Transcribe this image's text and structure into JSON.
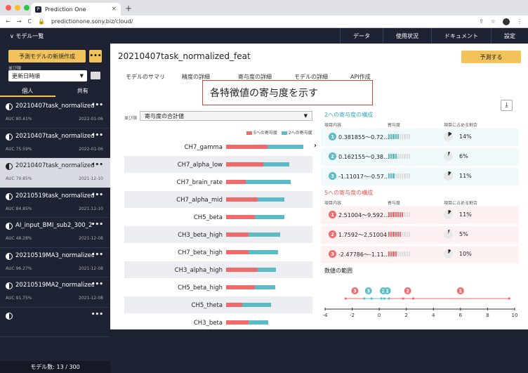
{
  "browser": {
    "tab_title": "Prediction One",
    "tab_close": "×",
    "new_tab": "+",
    "url": "predictionone.sony.biz/cloud/",
    "nav_back": "←",
    "nav_forward": "→",
    "nav_reload": "C",
    "lock": "🔒",
    "share": "⇪",
    "star": "☆",
    "menu": "⋮",
    "favicon": "P"
  },
  "appbar": {
    "model_list": "∨ モデル一覧",
    "nav": [
      "データ",
      "使用状況",
      "ドキュメント",
      "設定"
    ]
  },
  "sidebar": {
    "new_model": "予測モデルの新規作成",
    "more": "•••",
    "sort_label": "並び順",
    "sort_value": "更新日時順",
    "sort_arrow": "▼",
    "tabs": [
      "個人",
      "共有"
    ],
    "models": [
      {
        "name": "20210407task_normalized…",
        "auc": "AUC 80.41%",
        "date": "2022-01-06"
      },
      {
        "name": "20210407task_normalized…",
        "auc": "AUC 75.59%",
        "date": "2022-01-06"
      },
      {
        "name": "20210407task_normalized…",
        "auc": "AUC 79.85%",
        "date": "2021-12-10"
      },
      {
        "name": "20210519task_normalized…",
        "auc": "AUC 84.85%",
        "date": "2021-12-10"
      },
      {
        "name": "AI_input_BMI_sub2_300_2",
        "auc": "AUC 48.28%",
        "date": "2021-12-08"
      },
      {
        "name": "20210519MA3_normalized…",
        "auc": "AUC 96.27%",
        "date": "2021-12-08"
      },
      {
        "name": "20210519MA2_normalized…",
        "auc": "AUC 91.75%",
        "date": "2021-12-08"
      },
      {
        "name": "",
        "auc": "",
        "date": ""
      }
    ],
    "item_more": "•••",
    "count": "モデル数: 13 / 300"
  },
  "main": {
    "title": "20210407task_normalized_feat",
    "predict": "予測する",
    "tabs": [
      "モデルのサマリ",
      "精度の詳細",
      "寄与度の詳細",
      "モデルの詳細",
      "API作成"
    ],
    "callout": "各特徴値の寄与度を示す",
    "download": "⤓",
    "sort_label": "並び順",
    "sort_value": "寄与度の合計値",
    "sort_arrow": "▼",
    "legend": [
      "5への寄与度",
      "2への寄与度"
    ],
    "chevron": "›",
    "features": [
      {
        "name": "CH7_gamma",
        "neg": 0.56,
        "pos": 0.49
      },
      {
        "name": "CH7_alpha_low",
        "neg": 0.5,
        "pos": 0.36
      },
      {
        "name": "CH7_brain_rate",
        "neg": 0.27,
        "pos": 0.61
      },
      {
        "name": "CH7_alpha_mid",
        "neg": 0.43,
        "pos": 0.36
      },
      {
        "name": "CH5_beta",
        "neg": 0.39,
        "pos": 0.4
      },
      {
        "name": "CH3_beta_high",
        "neg": 0.3,
        "pos": 0.43
      },
      {
        "name": "CH7_beta_high",
        "neg": 0.3,
        "pos": 0.4
      },
      {
        "name": "CH3_alpha_high",
        "neg": 0.43,
        "pos": 0.25
      },
      {
        "name": "CH5_beta_high",
        "neg": 0.39,
        "pos": 0.28
      },
      {
        "name": "CH5_theta",
        "neg": 0.22,
        "pos": 0.39
      },
      {
        "name": "CH3_beta",
        "neg": 0.3,
        "pos": 0.27
      }
    ],
    "contrib2": {
      "title": "2への寄与度の構成",
      "headers": [
        "項目内容",
        "寄与度",
        "項目に占める割合"
      ],
      "rows": [
        {
          "badge": "1",
          "range": "0.381855〜0.72…",
          "level": 5,
          "pct": "14%",
          "share": 0.14
        },
        {
          "badge": "2",
          "range": "0.162155〜0.38…",
          "level": 4,
          "pct": "6%",
          "share": 0.06
        },
        {
          "badge": "3",
          "range": "-1.11017〜-0.57…",
          "level": 3,
          "pct": "11%",
          "share": 0.11
        }
      ]
    },
    "contrib5": {
      "title": "5への寄与度の構成",
      "headers": [
        "項目内容",
        "寄与度",
        "項目に占める割合"
      ],
      "rows": [
        {
          "badge": "1",
          "range": "2.51004〜9.592…",
          "level": 7,
          "pct": "11%",
          "share": 0.11
        },
        {
          "badge": "2",
          "range": "1.7592〜2.51004",
          "level": 6,
          "pct": "5%",
          "share": 0.05
        },
        {
          "badge": "3",
          "range": "-2.47786〜-1.11…",
          "level": 4,
          "pct": "10%",
          "share": 0.1
        }
      ]
    },
    "range": {
      "title": "数値の範囲",
      "ticks": [
        "-4",
        "-2",
        "0",
        "2",
        "4",
        "6",
        "8",
        "10"
      ],
      "markers": [
        {
          "label": "3",
          "value": -1.8,
          "color": "#ef6b6b"
        },
        {
          "label": "3",
          "value": -0.8,
          "color": "#5bbcc7"
        },
        {
          "label": "2",
          "value": 0.3,
          "color": "#5bbcc7"
        },
        {
          "label": "1",
          "value": 0.6,
          "color": "#5bbcc7"
        },
        {
          "label": "2",
          "value": 2.1,
          "color": "#ef6b6b"
        },
        {
          "label": "1",
          "value": 6.0,
          "color": "#ef6b6b"
        }
      ]
    }
  },
  "colors": {
    "accent": "#f3c35b",
    "teal": "#5bbcc7",
    "red": "#ef6b6b",
    "nav": "#1e2333"
  }
}
